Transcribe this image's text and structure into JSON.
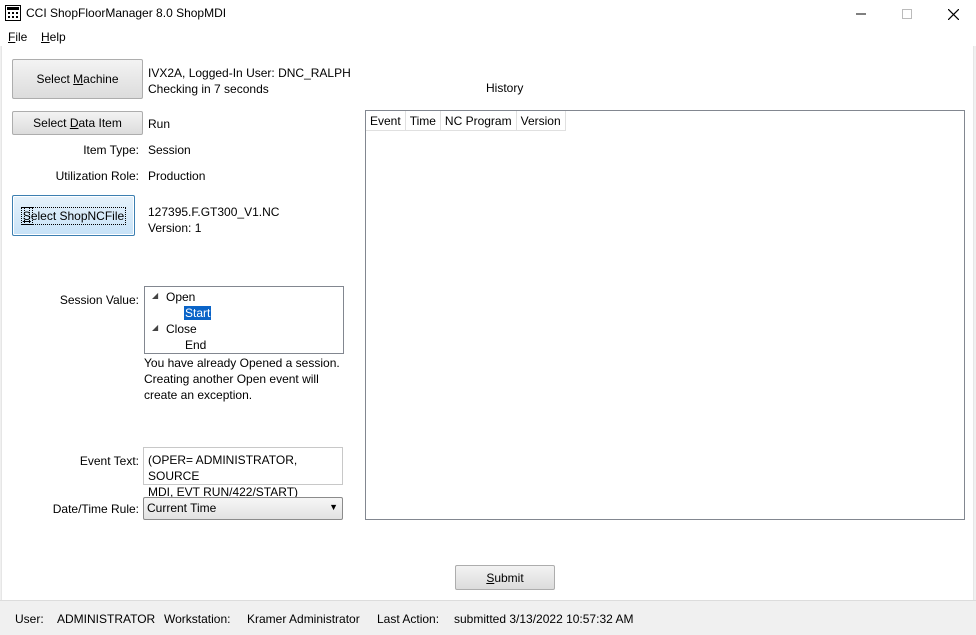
{
  "window": {
    "title": "CCI ShopFloorManager 8.0 ShopMDI",
    "minimize_glyph": "—",
    "maximize_glyph": "☐",
    "close_glyph": "✕"
  },
  "menu": {
    "file": {
      "accel": "F",
      "rest": "ile"
    },
    "help": {
      "accel": "H",
      "rest": "elp"
    }
  },
  "buttons": {
    "select_machine": {
      "pre": "Select ",
      "accel": "M",
      "post": "achine"
    },
    "select_data_item": {
      "pre": "Select ",
      "accel": "D",
      "post": "ata Item"
    },
    "select_shopncfile": {
      "pre": "",
      "accel": "S",
      "post": "elect ShopNCFile"
    },
    "submit": {
      "pre": "",
      "accel": "S",
      "post": "ubmit"
    }
  },
  "machine": {
    "status_line1": "IVX2A, Logged-In User: DNC_RALPH",
    "status_line2": "Checking in 7 seconds"
  },
  "data_item": {
    "value": "Run",
    "item_type_label": "Item Type:",
    "item_type_value": "Session",
    "utilization_role_label": "Utilization Role:",
    "utilization_role_value": "Production"
  },
  "shopncfile": {
    "file_name": "127395.F.GT300_V1.NC",
    "version": "Version: 1"
  },
  "session": {
    "label": "Session Value:",
    "tree": [
      {
        "label": "Open",
        "children": [
          "Start"
        ]
      },
      {
        "label": "Close",
        "children": [
          "End"
        ]
      }
    ],
    "selected": "Start",
    "warning_line1": "You have already Opened a session.",
    "warning_line2": "Creating another Open event will",
    "warning_line3": "create an exception."
  },
  "event_text": {
    "label": "Event Text:",
    "line1": "(OPER= ADMINISTRATOR, SOURCE",
    "line2": "MDI, EVT RUN/422/START)"
  },
  "datetime_rule": {
    "label": "Date/Time Rule:",
    "selected": "Current Time"
  },
  "history": {
    "title": "History",
    "columns": [
      "Event",
      "Time",
      "NC Program",
      "Version"
    ],
    "rows": []
  },
  "status_bar": {
    "user_label": "User:",
    "user_value": "ADMINISTRATOR",
    "workstation_label": "Workstation:",
    "workstation_value": "Kramer Administrator",
    "last_action_label": "Last Action:",
    "last_action_value": "submitted 3/13/2022 10:57:32 AM"
  }
}
